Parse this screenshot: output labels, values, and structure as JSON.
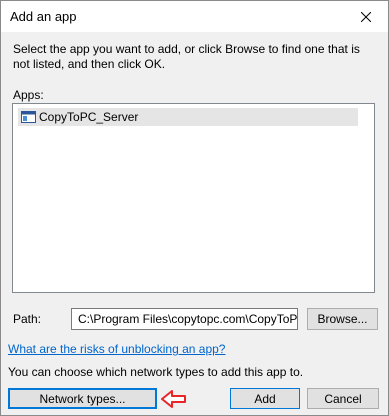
{
  "dialog": {
    "title": "Add an app",
    "instruction": "Select the app you want to add, or click Browse to find one that is not listed, and then click OK."
  },
  "apps": {
    "label": "Apps:",
    "items": [
      {
        "name": "CopyToPC_Server",
        "selected": true
      }
    ]
  },
  "path": {
    "label": "Path:",
    "value": "C:\\Program Files\\copytopc.com\\CopyToPC_Server\\CopyToPC_Server.exe",
    "browse_label": "Browse..."
  },
  "risks_link": "What are the risks of unblocking an app?",
  "network_note": "You can choose which network types to add this app to.",
  "buttons": {
    "network_types": "Network types...",
    "add": "Add",
    "cancel": "Cancel"
  },
  "colors": {
    "accent": "#0078d7",
    "link": "#0066cc",
    "annotation_arrow": "#e8262a"
  },
  "icons": {
    "close": "close-icon",
    "app": "app-window-icon",
    "annotation": "red-arrow-icon"
  }
}
